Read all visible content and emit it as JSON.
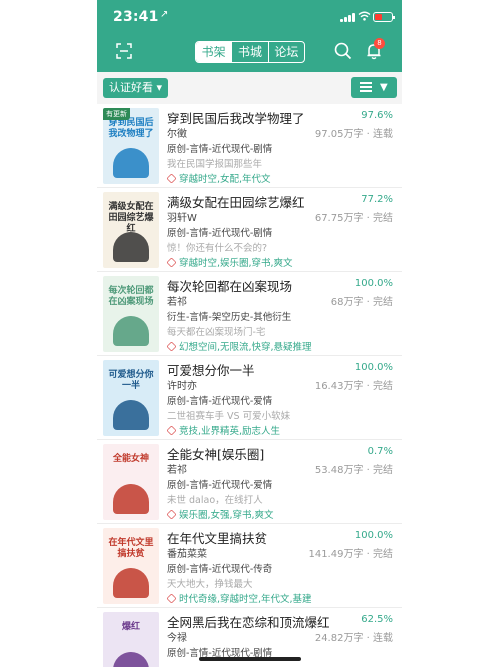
{
  "status": {
    "time": "23:41",
    "location_arrow": "↗",
    "battery_color": "#ff3b30"
  },
  "header": {
    "tabs": [
      {
        "label": "书架",
        "active": true
      },
      {
        "label": "书城",
        "active": false
      },
      {
        "label": "论坛",
        "active": false
      }
    ],
    "notification_count": "8",
    "icons": [
      "scan-icon",
      "search-icon",
      "bell-icon"
    ]
  },
  "filter": {
    "label": "认证好看 ▾",
    "menu_icon": "list-icon"
  },
  "colors": {
    "accent": "#35a98b",
    "badge": "#ff4d3d"
  },
  "books": [
    {
      "title": "穿到民国后我改学物理了",
      "progress": "97.6%",
      "author": "尔徵",
      "meta": "97.05万字 · 连载",
      "genre": "原创-言情-近代现代-剧情",
      "desc": "我在民国学报国那些年",
      "tags": "穿越时空,女配,年代文",
      "cover_title": "穿到民国后我改物理了",
      "cover_bg": "#dfeef6",
      "cover_fg": "#1e7fc2",
      "cover_label": "有更新"
    },
    {
      "title": "满级女配在田园综艺爆红",
      "progress": "77.2%",
      "author": "羽轩W",
      "meta": "67.75万字 · 完结",
      "genre": "原创-言情-近代现代-剧情",
      "desc": "惊！你还有什么不会的?",
      "tags": "穿越时空,娱乐圈,穿书,爽文",
      "cover_title": "满级女配在田园综艺爆红",
      "cover_bg": "#f6f0e4",
      "cover_fg": "#333333",
      "cover_label": ""
    },
    {
      "title": "每次轮回都在凶案现场",
      "progress": "100.0%",
      "author": "若祁",
      "meta": "68万字 · 完结",
      "genre": "衍生-言情-架空历史-其他衍生",
      "desc": "每天都在凶案现场门-宅",
      "tags": "幻想空间,无限流,快穿,悬疑推理",
      "cover_title": "每次轮回都在凶案现场",
      "cover_bg": "#e8f3ea",
      "cover_fg": "#4f9a7a",
      "cover_label": ""
    },
    {
      "title": "可爱想分你一半",
      "progress": "100.0%",
      "author": "许时亦",
      "meta": "16.43万字 · 完结",
      "genre": "原创-言情-近代现代-爱情",
      "desc": "二世祖赛车手 VS 可爱小软妹",
      "tags": "竞技,业界精英,励志人生",
      "cover_title": "可爱想分你一半",
      "cover_bg": "#d8ecf7",
      "cover_fg": "#1f5a8c",
      "cover_label": ""
    },
    {
      "title": "全能女神[娱乐圈]",
      "progress": "0.7%",
      "author": "若祁",
      "meta": "53.48万字 · 完结",
      "genre": "原创-言情-近代现代-爱情",
      "desc": "未世 dalao，在线打人",
      "tags": "娱乐圈,女强,穿书,爽文",
      "cover_title": "全能女神",
      "cover_bg": "#fbeef0",
      "cover_fg": "#c0392b",
      "cover_label": ""
    },
    {
      "title": "在年代文里搞扶贫",
      "progress": "100.0%",
      "author": "番茄菜菜",
      "meta": "141.49万字 · 完结",
      "genre": "原创-言情-近代现代-传奇",
      "desc": "天大地大，挣钱最大",
      "tags": "时代奇缘,穿越时空,年代文,基建",
      "cover_title": "在年代文里搞扶贫",
      "cover_bg": "#fdeee9",
      "cover_fg": "#c0392b",
      "cover_label": ""
    },
    {
      "title": "全网黑后我在恋综和顶流爆红",
      "progress": "62.5%",
      "author": "今禄",
      "meta": "24.82万字 · 连载",
      "genre": "原创-言情-近代现代-剧情",
      "desc": "",
      "tags": "",
      "cover_title": "爆红",
      "cover_bg": "#ece4f3",
      "cover_fg": "#6b3a8c",
      "cover_label": ""
    }
  ]
}
